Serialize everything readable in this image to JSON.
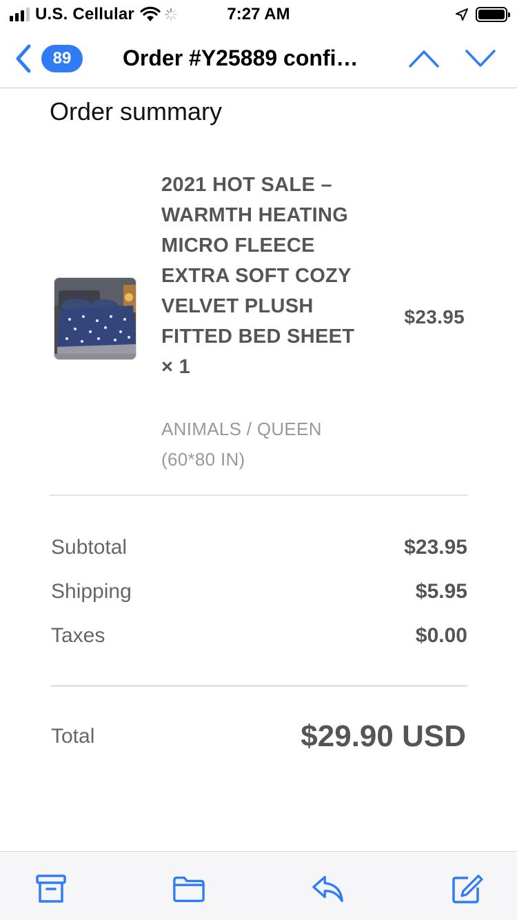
{
  "status_bar": {
    "carrier": "U.S. Cellular",
    "time": "7:27 AM"
  },
  "nav": {
    "unread_count": "89",
    "title": "Order #Y25889 confi…",
    "accent_color": "#2f7cf6"
  },
  "order": {
    "heading": "Order summary",
    "items": [
      {
        "title": "2021 HOT SALE – WARMTH HEATING MICRO FLEECE EXTRA SOFT COZY VELVET PLUSH FITTED BED SHEET × 1",
        "variant": "ANIMALS / QUEEN (60*80 IN)",
        "price": "$23.95"
      }
    ]
  },
  "summary": {
    "subtotal_label": "Subtotal",
    "subtotal_value": "$23.95",
    "shipping_label": "Shipping",
    "shipping_value": "$5.95",
    "taxes_label": "Taxes",
    "taxes_value": "$0.00",
    "total_label": "Total",
    "total_value": "$29.90 USD"
  },
  "toolbar": {
    "icons": [
      "archive-icon",
      "folder-icon",
      "reply-icon",
      "compose-icon"
    ]
  }
}
